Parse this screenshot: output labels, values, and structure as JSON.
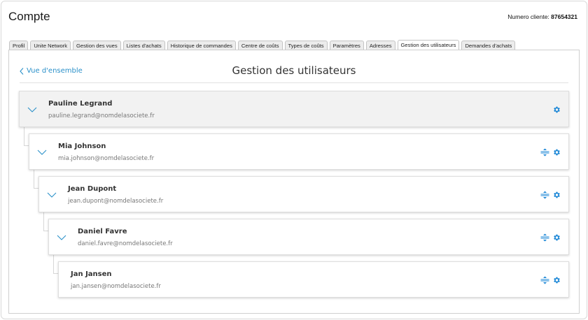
{
  "header": {
    "title": "Compte",
    "client_label": "Numero cliente:",
    "client_number": "87654321"
  },
  "tabs": [
    {
      "label": "Profil"
    },
    {
      "label": "Unite Network"
    },
    {
      "label": "Gestion des vues"
    },
    {
      "label": "Listes d'achats"
    },
    {
      "label": "Historique de commandes"
    },
    {
      "label": "Centre de coûts"
    },
    {
      "label": "Types de coûts"
    },
    {
      "label": "Paramètres"
    },
    {
      "label": "Adresses"
    },
    {
      "label": "Gestion des utilisateurs",
      "active": true
    },
    {
      "label": "Demandes d'achats"
    }
  ],
  "main": {
    "back_label": "Vue d'ensemble",
    "title": "Gestion des utilisateurs"
  },
  "users": [
    {
      "name": "Pauline Legrand",
      "email": "pauline.legrand@nomdelasociete.fr",
      "level": 0
    },
    {
      "name": "Mia Johnson",
      "email": "mia.johnson@nomdelasociete.fr",
      "level": 1
    },
    {
      "name": "Jean Dupont",
      "email": "jean.dupont@nomdelasociete.fr",
      "level": 2
    },
    {
      "name": "Daniel Favre",
      "email": "daniel.favre@nomdelasociete.fr",
      "level": 3
    },
    {
      "name": "Jan Jansen",
      "email": "jan.jansen@nomdelasociete.fr",
      "level": 4
    }
  ],
  "colors": {
    "accent": "#2a90c9",
    "icon": "#1a86d6",
    "root_card_bg": "#f2f2f2"
  },
  "icons": {
    "back": "chevron-left-icon",
    "expand": "chevron-down-icon",
    "settings": "gear-icon",
    "reorder": "move-vertical-icon"
  }
}
